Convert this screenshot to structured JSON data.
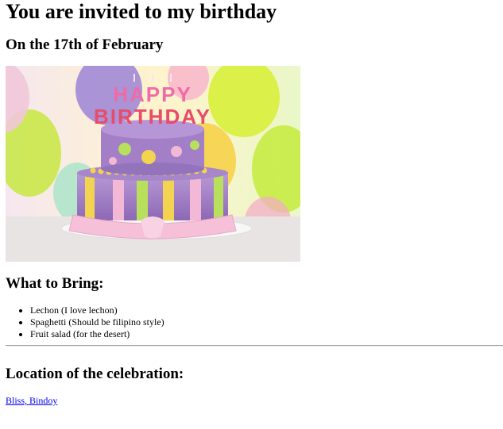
{
  "page": {
    "title": "You are invited to my birthday",
    "date_heading": "On the 17th of February",
    "image": {
      "icon": "birthday-cake-photo",
      "cake_text_line1": "HAPPY",
      "cake_text_line2": "BIRTHDAY"
    },
    "bring": {
      "heading": "What to Bring:",
      "items": [
        "Lechon (I love lechon)",
        "Spaghetti (Should be filipino style)",
        "Fruit salad (for the desert)"
      ]
    },
    "location": {
      "heading": "Location of the celebration:",
      "link_text": "Bliss, Bindoy"
    },
    "colors": {
      "link": "#0000ee",
      "rule": "#9a9a9a"
    }
  }
}
